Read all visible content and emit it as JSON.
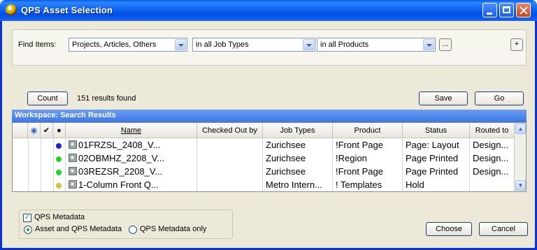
{
  "window": {
    "title": "QPS Asset Selection"
  },
  "find": {
    "label": "Find Items:",
    "scope": "Projects, Articles, Others",
    "job_types": "in all Job Types",
    "products": "in all Products",
    "more_label": "...",
    "add_label": "+"
  },
  "toolbar": {
    "count_label": "Count",
    "results_text": "151 results found",
    "save_label": "Save",
    "go_label": "Go"
  },
  "grid": {
    "title": "Workspace: Search Results",
    "columns": [
      "Name",
      "Checked Out by",
      "Job Types",
      "Product",
      "Status",
      "Routed to"
    ],
    "rows": [
      {
        "dot_color": "#1e1edc",
        "name": "01FRZSL_2408_V...",
        "checked_out_by": "",
        "job_types": "Zurichsee",
        "product": "!Front Page",
        "status": "Page: Layout",
        "routed_to": "Design..."
      },
      {
        "dot_color": "#22d622",
        "name": "02OBMHZ_2208_V...",
        "checked_out_by": "",
        "job_types": "Zurichsee",
        "product": "!Region",
        "status": "Page Printed",
        "routed_to": "Design..."
      },
      {
        "dot_color": "#22d622",
        "name": "03REZSR_2208_V...",
        "checked_out_by": "",
        "job_types": "Zurichsee",
        "product": "!Front Page",
        "status": "Page Printed",
        "routed_to": "Design..."
      },
      {
        "dot_color": "#d6c23a",
        "name": "1-Column Front Q...",
        "checked_out_by": "",
        "job_types": "Metro Intern...",
        "product": "! Templates",
        "status": "Hold",
        "routed_to": ""
      }
    ]
  },
  "metadata": {
    "checkbox_label": "QPS Metadata",
    "option_both": "Asset and QPS Metadata",
    "option_qps_only": "QPS Metadata only"
  },
  "footer": {
    "choose_label": "Choose",
    "cancel_label": "Cancel"
  }
}
